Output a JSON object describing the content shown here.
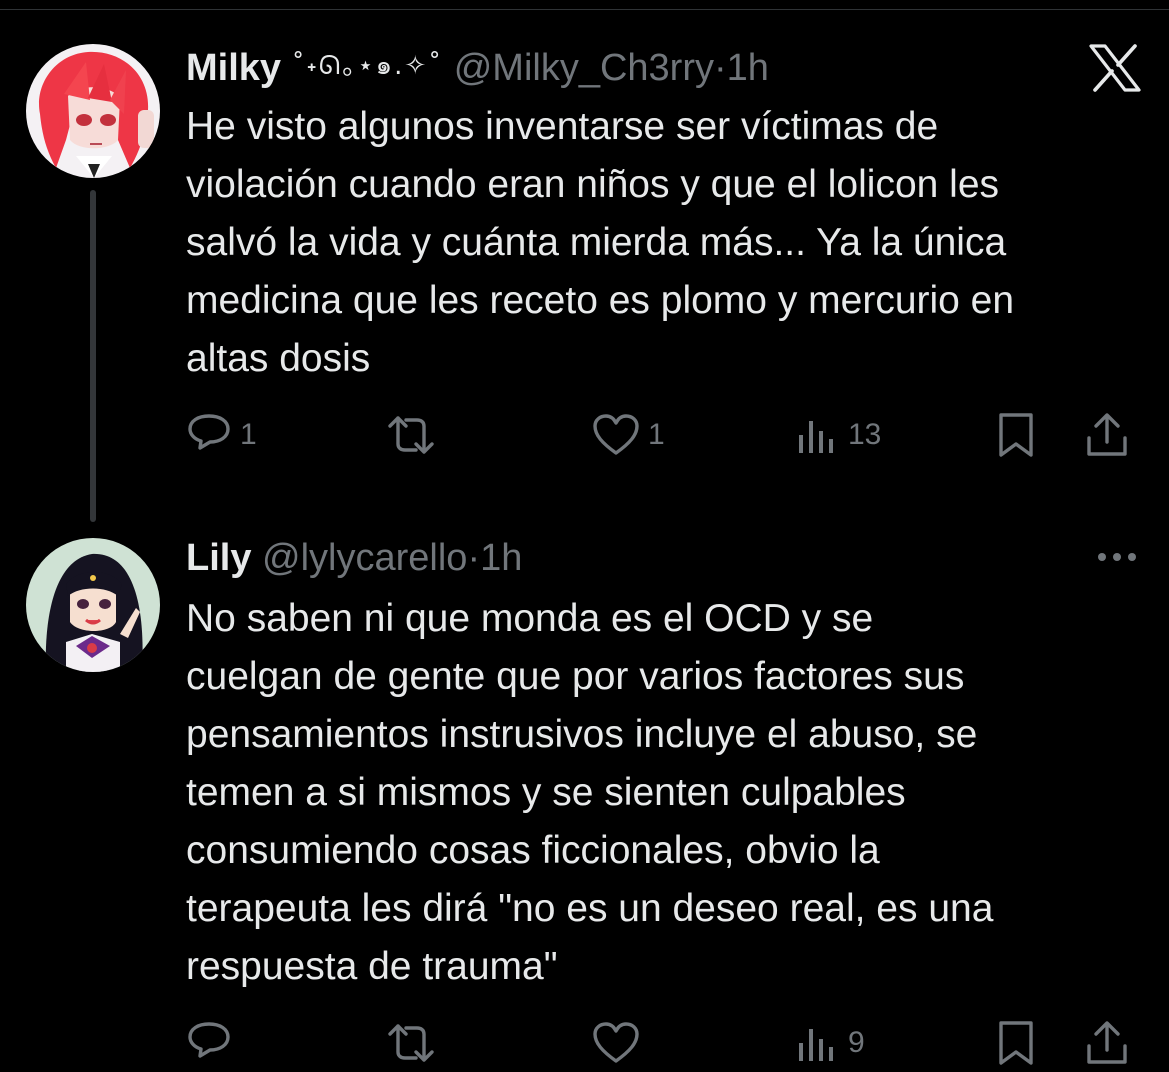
{
  "tweets": [
    {
      "display_name": "Milky",
      "name_decoration": "˚˖ᘏ｡⋆๑.✧˚",
      "handle": "@Milky_Ch3rry",
      "separator": "·",
      "time": "1h",
      "text": "He visto algunos inventarse ser víctimas de\nviolación cuando eran niños y que el lolicon les\nsalvó la vida y cuánta mierda más... Ya la única\nmedicina que les receto es plomo y mercurio en\naltas dosis",
      "stats": {
        "replies": "1",
        "retweets": "",
        "likes": "1",
        "views": "13"
      },
      "avatar_icon": "red-haired-anime-avatar"
    },
    {
      "display_name": "Lily",
      "handle": "@lylycarello",
      "separator": "·",
      "time": "1h",
      "text": "No saben ni que monda es el OCD y se\ncuelgan de gente que por varios factores sus\npensamientos instrusivos incluye el abuso, se\ntemen a si mismos y se sienten culpables\nconsumiendo cosas ficcionales, obvio la\nterapeuta les dirá \"no es un deseo real, es una\nrespuesta de trauma\"",
      "stats": {
        "replies": "",
        "retweets": "",
        "likes": "",
        "views": "9"
      },
      "avatar_icon": "sailor-anime-avatar"
    }
  ],
  "icons": {
    "app_logo": "x-logo-icon",
    "more": "more-dots-icon",
    "reply": "reply-icon",
    "retweet": "retweet-icon",
    "like": "heart-icon",
    "views": "views-chart-icon",
    "bookmark": "bookmark-icon",
    "share": "share-icon"
  },
  "colors": {
    "background": "#000000",
    "text_primary": "#e7e9ea",
    "text_secondary": "#71767b",
    "thread_line": "#333639"
  }
}
